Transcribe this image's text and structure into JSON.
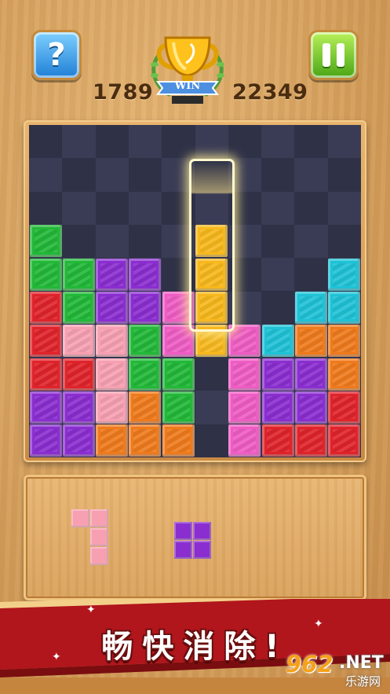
{
  "header": {
    "help_label": "?",
    "trophy_label": "WIN",
    "score_left": "1789",
    "score_right": "22349"
  },
  "board": {
    "cols": 10,
    "rows": 10,
    "colors": {
      "G": "#22b838",
      "P": "#8a2ed0",
      "R": "#e0232b",
      "K": "#f7a0b2",
      "M": "#ef5cc4",
      "C": "#1fc2d6",
      "O": "#ef7a1c",
      "Y": "#f7b81c"
    },
    "grid": [
      "..........",
      "..........",
      "..........",
      "G.........",
      "GGPP.....C",
      "RGPPM...CCO",
      "RKKGM.MCOO",
      "RRKGG.MPPO",
      "PPKOG.MPPR",
      "PPOOO.MRRR"
    ],
    "falling_piece": {
      "color": "Y",
      "col": 5,
      "rows": [
        3,
        4,
        5,
        6
      ]
    }
  },
  "tray": {
    "pieces": [
      {
        "color": "#f7a0b2",
        "cells": [
          [
            0,
            0
          ],
          [
            1,
            0
          ],
          [
            1,
            1
          ],
          [
            1,
            2
          ]
        ]
      },
      {
        "color": "#8a2ed0",
        "cells": [
          [
            0,
            0
          ],
          [
            1,
            0
          ],
          [
            0,
            1
          ],
          [
            1,
            1
          ]
        ]
      }
    ]
  },
  "banner": {
    "slogan": "畅快消除!"
  },
  "watermark": {
    "number": "962",
    "domain": ".NET",
    "name": "乐游网"
  }
}
